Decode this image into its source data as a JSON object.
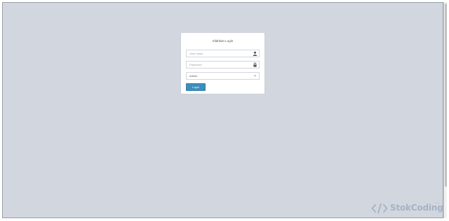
{
  "login": {
    "title": "Silahkan Login",
    "username_placeholder": "User name",
    "password_placeholder": "Password",
    "role_selected": "Admin",
    "button_label": "Login"
  },
  "icons": {
    "username": "user-icon",
    "password": "lock-icon",
    "select": "caret-down-icon",
    "watermark": "code-brackets-icon"
  },
  "watermark": {
    "brand": "StokCoding",
    "sub": ".com"
  },
  "colors": {
    "background": "#d2d6de",
    "button": "#3c8dbc",
    "watermark": "#a6b3c5"
  }
}
